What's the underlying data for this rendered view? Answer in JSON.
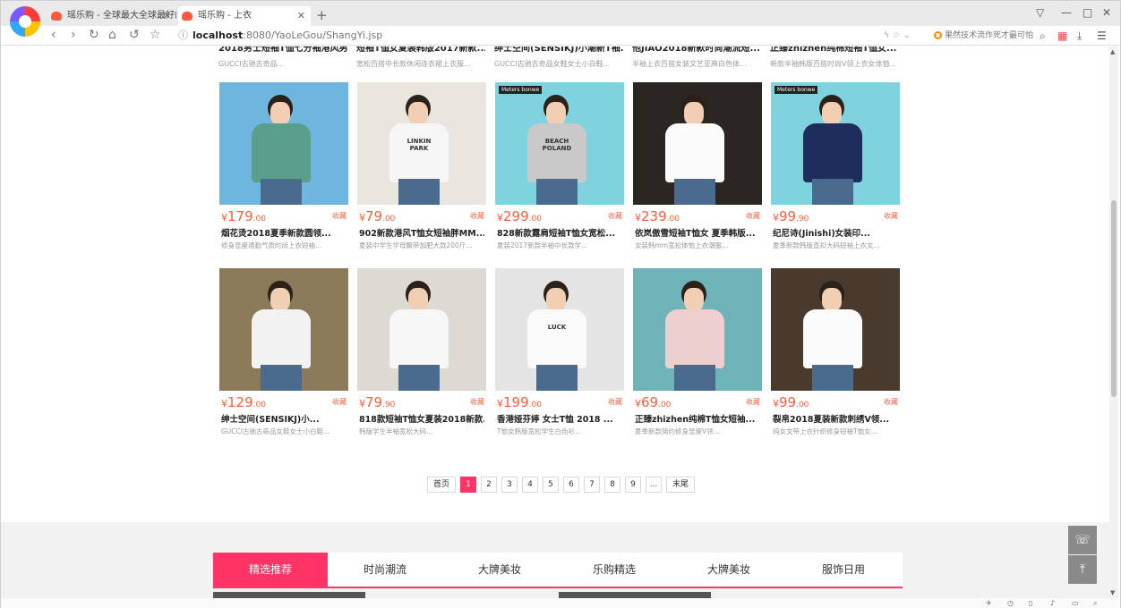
{
  "browser": {
    "tabs": [
      {
        "label": "瑶乐购 - 全球最大全球最好的网",
        "active": false
      },
      {
        "label": "瑶乐购 - 上衣",
        "active": true
      }
    ],
    "new_tab": "+",
    "url_host": "localhost",
    "url_rest": ":8080/YaoLeGou/ShangYi.jsp",
    "search_text": "果然技术流作死才最可怕",
    "window_controls": [
      "▽",
      "—",
      "□",
      "✕"
    ]
  },
  "previous_row": [
    {
      "title": "2018男士短袖T恤七分袖港风男...",
      "desc": "GUCCI古驰古奇品..."
    },
    {
      "title": "短袖T恤女夏装韩版2017新款...",
      "desc": "宽松百搭中长款休闲连衣裙上衣服..."
    },
    {
      "title": "绅士空间(SENSIKJ)小潮新T袖...",
      "desc": "GUCCI古驰古奇品女鞋女士小白鞋..."
    },
    {
      "title": "他JIAO2018新款时尚潮流短...",
      "desc": "半袖上衣百搭女装文艺亚麻白色体..."
    },
    {
      "title": "正臻zhizhen纯棉短袖T恤女...",
      "desc": "新款半袖韩版百搭时尚V领上衣女体恤..."
    }
  ],
  "products": [
    {
      "price_int": "179",
      "price_dec": ".00",
      "fav": "收藏",
      "title": "烟花烫2018夏季新款圆领...",
      "desc": "修身显瘦通勤气质时尚上衣短袖...",
      "bg": "#6fb6de",
      "shirt": "#5c9e8c",
      "print": "",
      "tag": ""
    },
    {
      "price_int": "79",
      "price_dec": ".00",
      "fav": "收藏",
      "title": "902新款港风T恤女短袖胖MM...",
      "desc": "夏装中学生学母飘带加肥大款200斤...",
      "bg": "#e9e6e0",
      "shirt": "#f6f6f6",
      "print": "LINKIN PARK",
      "tag": ""
    },
    {
      "price_int": "299",
      "price_dec": ".00",
      "fav": "收藏",
      "title": "828新款露肩短袖T恤女宽松...",
      "desc": "夏装2017新款半袖中长款学...",
      "bg": "#7fd3de",
      "shirt": "#c9c9c9",
      "print": "BEACH POLAND",
      "tag": "Meters bonwe"
    },
    {
      "price_int": "239",
      "price_dec": ".00",
      "fav": "收藏",
      "title": "依岚傲雪短袖T恤女 夏季韩版...",
      "desc": "女装韩mm宽松体恤上衣潮服...",
      "bg": "#2a2622",
      "shirt": "#fbfbfb",
      "print": "",
      "tag": ""
    },
    {
      "price_int": "99",
      "price_dec": ".90",
      "fav": "收藏",
      "title": "纪尼诗(Jinishi)女装印...",
      "desc": "夏季新款韩版直扣大码短袖上衣女...",
      "bg": "#7fd3de",
      "shirt": "#1f2d5c",
      "print": "",
      "tag": "Meters bonwe"
    },
    {
      "price_int": "129",
      "price_dec": ".00",
      "fav": "收藏",
      "title": "绅士空间(SENSIKJ)小...",
      "desc": "GUCCI古驰古奇品女鞋女士小白鞋...",
      "bg": "#8a7a5a",
      "shirt": "#f2f2f2",
      "print": "",
      "tag": ""
    },
    {
      "price_int": "79",
      "price_dec": ".90",
      "fav": "收藏",
      "title": "818款短袖T恤女夏装2018新款...",
      "desc": "韩版学生半袖宽松大码...",
      "bg": "#dddad4",
      "shirt": "#f7f7f7",
      "print": "",
      "tag": ""
    },
    {
      "price_int": "199",
      "price_dec": ".00",
      "fav": "收藏",
      "title": "香港娅芬婷 女士T恤 2018 ...",
      "desc": "T恤女韩版宽松学生白色衫...",
      "bg": "#e4e4e4",
      "shirt": "#fafafa",
      "print": "LUCK",
      "tag": ""
    },
    {
      "price_int": "69",
      "price_dec": ".00",
      "fav": "收藏",
      "title": "正臻zhizhen纯棉T恤女短袖...",
      "desc": "夏季新款简约修身显瘦V领...",
      "bg": "#6eb3b8",
      "shirt": "#eecfcf",
      "print": "",
      "tag": ""
    },
    {
      "price_int": "99",
      "price_dec": ".00",
      "fav": "收藏",
      "title": "裂帛2018夏装新款刺绣V领...",
      "desc": "纯女文带上衣针织修身短袖T恤女...",
      "bg": "#4a3a2e",
      "shirt": "#fbfbfb",
      "print": "",
      "tag": ""
    }
  ],
  "pagination": {
    "first": "首页",
    "pages": [
      "1",
      "2",
      "3",
      "4",
      "5",
      "6",
      "7",
      "8",
      "9"
    ],
    "active": "1",
    "ellipsis": "...",
    "last": "末尾"
  },
  "category_tabs": [
    "精选推荐",
    "时尚潮流",
    "大牌美妆",
    "乐购精选",
    "大牌美妆",
    "服饰日用"
  ],
  "colors": {
    "accent": "#ff3366",
    "price": "#f4603e"
  }
}
